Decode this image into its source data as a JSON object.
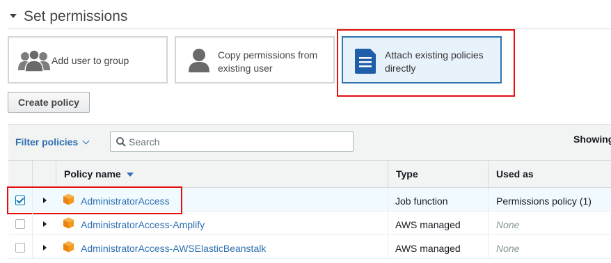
{
  "section": {
    "title": "Set permissions"
  },
  "options": [
    {
      "label": "Add user to group",
      "icon": "users-group-icon"
    },
    {
      "label": "Copy permissions from existing user",
      "icon": "user-icon"
    },
    {
      "label": "Attach existing policies directly",
      "icon": "document-icon",
      "selected": true
    }
  ],
  "create_policy_label": "Create policy",
  "filter": {
    "label": "Filter policies",
    "search_placeholder": "Search",
    "showing": "Showing"
  },
  "table": {
    "headers": {
      "policy_name": "Policy name",
      "type": "Type",
      "used_as": "Used as"
    },
    "rows": [
      {
        "name": "AdministratorAccess",
        "type": "Job function",
        "used_as": "Permissions policy (1)",
        "checked": true
      },
      {
        "name": "AdministratorAccess-Amplify",
        "type": "AWS managed",
        "used_as": "None",
        "checked": false
      },
      {
        "name": "AdministratorAccess-AWSElasticBeanstalk",
        "type": "AWS managed",
        "used_as": "None",
        "checked": false
      }
    ]
  },
  "colors": {
    "link": "#2d6fb1",
    "selected_card_bg": "#e8f2fb",
    "selected_card_border": "#2c75b2",
    "highlight": "#e3100d",
    "policy_icon": "#f79a1d"
  }
}
